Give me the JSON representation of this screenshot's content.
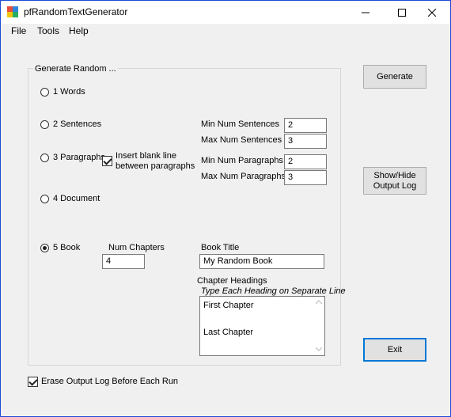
{
  "window": {
    "title": "pfRandomTextGenerator",
    "controls": {
      "minimize": "minimize",
      "maximize": "maximize",
      "close": "close"
    }
  },
  "menu": {
    "items": [
      "File",
      "Tools",
      "Help"
    ]
  },
  "group": {
    "legend": "Generate Random ...",
    "options": [
      {
        "label": "1 Words",
        "checked": false
      },
      {
        "label": "2 Sentences",
        "checked": false
      },
      {
        "label": "3 Paragraphs",
        "checked": false
      },
      {
        "label": "4 Document",
        "checked": false
      },
      {
        "label": "5 Book",
        "checked": true
      }
    ],
    "insert_blank_line": {
      "label_line1": "Insert blank line",
      "label_line2": "between paragraphs",
      "checked": true
    },
    "min_sentences": {
      "label": "Min Num Sentences",
      "value": "2"
    },
    "max_sentences": {
      "label": "Max Num Sentences",
      "value": "3"
    },
    "min_paragraphs": {
      "label": "Min Num Paragraphs",
      "value": "2"
    },
    "max_paragraphs": {
      "label": "Max Num Paragraphs",
      "value": "3"
    },
    "num_chapters": {
      "label": "Num Chapters",
      "value": "4"
    },
    "book_title": {
      "label": "Book Title",
      "value": "My Random Book"
    },
    "chapter_headings": {
      "label": "Chapter Headings",
      "hint": "Type Each Heading on Separate Line",
      "lines": [
        "First Chapter",
        "",
        "Last Chapter"
      ]
    }
  },
  "buttons": {
    "generate": "Generate",
    "show_hide_line1": "Show/Hide",
    "show_hide_line2": "Output Log",
    "exit": "Exit"
  },
  "erase_log": {
    "label": "Erase Output Log Before Each Run",
    "checked": true
  },
  "colors": {
    "accent": "#0078d7",
    "window_border": "#1e4bd8",
    "background": "#f0f0f0"
  }
}
